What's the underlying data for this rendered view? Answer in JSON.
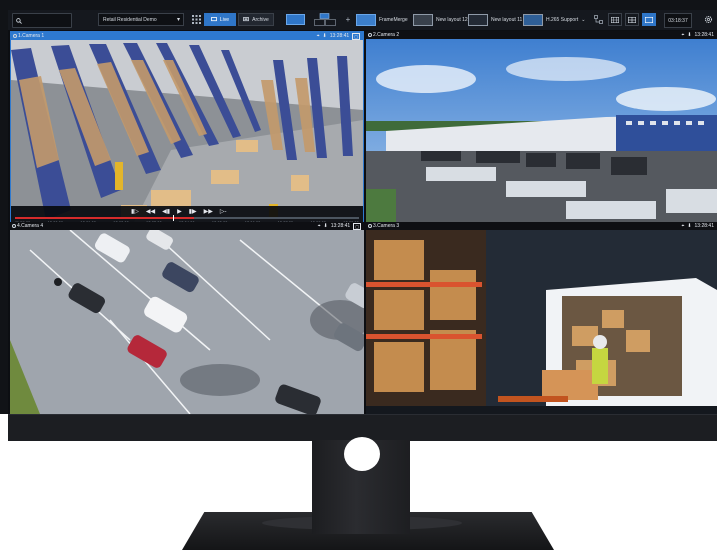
{
  "toolbar": {
    "search_placeholder": "",
    "site_name": "Retail Residential Demo",
    "mode_live": "Live",
    "mode_archive": "Archive",
    "layouts": [
      {
        "label": "FrameMerge",
        "selected": false
      },
      {
        "label": "New layout 12",
        "selected": false
      },
      {
        "label": "New layout 11",
        "selected": false
      },
      {
        "label": "H.265 Support",
        "selected": false
      }
    ],
    "clock": "03:18:37"
  },
  "cameras": [
    {
      "title": "1.Camera 1",
      "time": "13:28:41",
      "active": true
    },
    {
      "title": "2.Camera 2",
      "time": "13:28:41",
      "active": false
    },
    {
      "title": "4.Camera 4",
      "time": "13:28:41",
      "active": false
    },
    {
      "title": "3.Camera 3",
      "time": "13:28:41",
      "active": false
    }
  ],
  "playback": {
    "ticks": [
      "11:59:00",
      "12:00:00",
      "12:01:00",
      "12:02:00",
      "12:03:00",
      "12:04:00",
      "12:05:00",
      "12:06:00",
      "12:07:00",
      "12:08:00",
      "12:09:00"
    ]
  },
  "colors": {
    "accent": "#2e79cf",
    "timeline_recorded": "#d62b2b"
  }
}
